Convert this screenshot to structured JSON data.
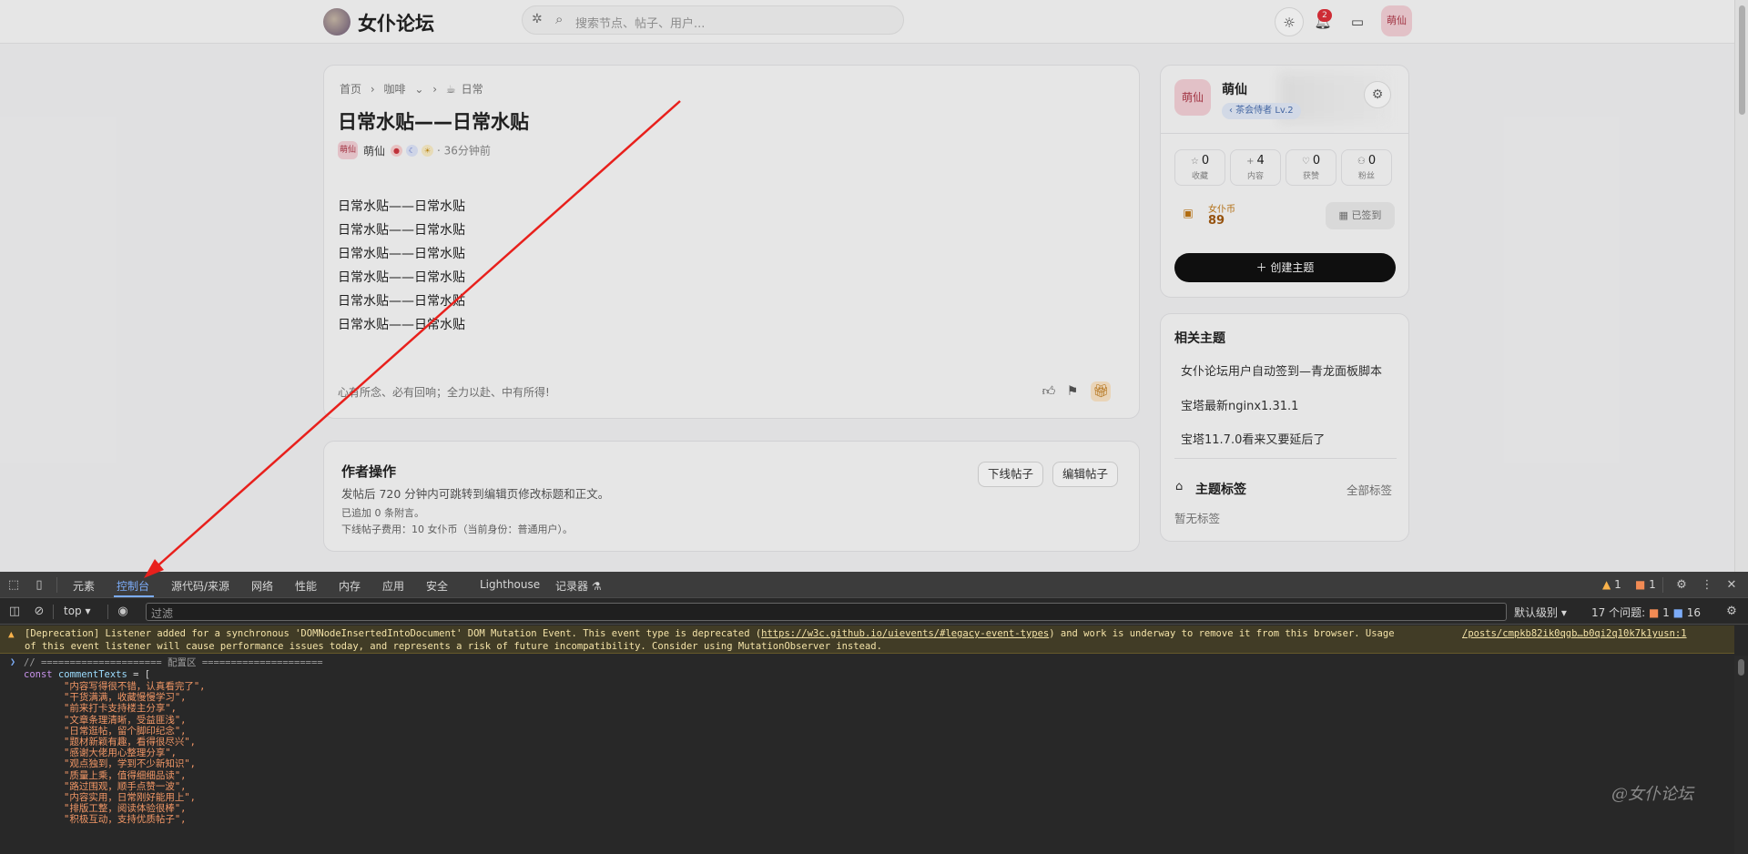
{
  "site": {
    "brand": "女仆论坛",
    "search_placeholder": "搜索节点、帖子、用户...",
    "notif_count": "2",
    "avatar_text": "萌仙"
  },
  "post": {
    "breadcrumb": [
      "首页",
      "›",
      "咖啡",
      "⌄",
      "›",
      "日常"
    ],
    "title": "日常水贴——日常水贴",
    "author_avatar": "萌仙",
    "author": "萌仙",
    "time": "· 36分钟前",
    "body": [
      "日常水贴——日常水贴",
      "日常水贴——日常水贴",
      "日常水贴——日常水贴",
      "日常水贴——日常水贴",
      "日常水贴——日常水贴",
      "日常水贴——日常水贴"
    ],
    "signature": "心有所念、必有回响；全力以赴、中有所得!"
  },
  "author_ops": {
    "title": "作者操作",
    "desc": "发帖后 720 分钟内可跳转到编辑页修改标题和正文。",
    "note1": "已追加 0 条附言。",
    "note2": "下线帖子费用：10 女仆币（当前身份：普通用户）。",
    "offline_label": "下线帖子",
    "edit_label": "编辑帖子"
  },
  "profile": {
    "avatar": "萌仙",
    "name": "萌仙",
    "badge": "‹ 茶会侍者 Lv.2",
    "stats": [
      {
        "icon": "☆",
        "value": "0",
        "label": "收藏"
      },
      {
        "icon": "+",
        "value": "4",
        "label": "内容"
      },
      {
        "icon": "♡",
        "value": "0",
        "label": "获赞"
      },
      {
        "icon": "⚇",
        "value": "0",
        "label": "粉丝"
      }
    ],
    "coin_label": "女仆币",
    "coin_value": "89",
    "checkin_label": "已签到",
    "create_label": "＋ 创建主题"
  },
  "related": {
    "title": "相关主题",
    "items": [
      "女仆论坛用户自动签到—青龙面板脚本",
      "宝塔最新nginx1.31.1",
      "宝塔11.7.0看来又要延后了"
    ],
    "tags_title": "主题标签",
    "tags_all": "全部标签",
    "tags_empty": "暂无标签"
  },
  "devtools": {
    "tabs": [
      "元素",
      "控制台",
      "源代码/来源",
      "网络",
      "性能",
      "内存",
      "应用",
      "安全",
      "Lighthouse",
      "记录器 ⚗"
    ],
    "active_tab": "控制台",
    "warn_count": "1",
    "err_count": "1",
    "context": "top ▾",
    "filter_placeholder": "过滤",
    "level": "默认级别 ▾",
    "issues_label": "17 个问题:",
    "issues_err": "1",
    "issues_info": "16",
    "warning_line1_pre": "[Deprecation] Listener added for a synchronous 'DOMNodeInsertedIntoDocument' DOM Mutation Event. This event type is deprecated (",
    "warning_link": "https://w3c.github.io/uievents/#legacy-event-types",
    "warning_line1_post": ") and work is underway to remove it from this browser. Usage ",
    "warning_src": "/posts/cmpkb82ik0qgb…b0qi2q10k7k1yusn:1",
    "warning_line2": "of this event listener will cause performance issues today, and represents a risk of future incompatibility. Consider using MutationObserver instead.",
    "code_comment": "// ===================== 配置区 =====================",
    "code_decl_kw": "const",
    "code_decl_var": "commentTexts",
    "code_decl_rest": " = [",
    "code_strings": [
      "\"内容写得很不错，认真看完了\",",
      "\"干货满满，收藏慢慢学习\",",
      "\"前来打卡支持楼主分享\",",
      "\"文章条理清晰，受益匪浅\",",
      "\"日常逛帖，留个脚印纪念\",",
      "\"题材新颖有趣，看得很尽兴\",",
      "\"感谢大佬用心整理分享\",",
      "\"观点独到，学到不少新知识\",",
      "\"质量上乘，值得细细品读\",",
      "\"路过围观，顺手点赞一波\",",
      "\"内容实用，日常刚好能用上\",",
      "\"排版工整，阅读体验很棒\",",
      "\"积极互动，支持优质帖子\","
    ],
    "watermark": "@女仆论坛"
  },
  "colors": {
    "annotation_arrow": "#e8201c",
    "devtools_bg": "#282828",
    "active_tab": "#7cacf8",
    "warning_bg": "#413c26"
  }
}
